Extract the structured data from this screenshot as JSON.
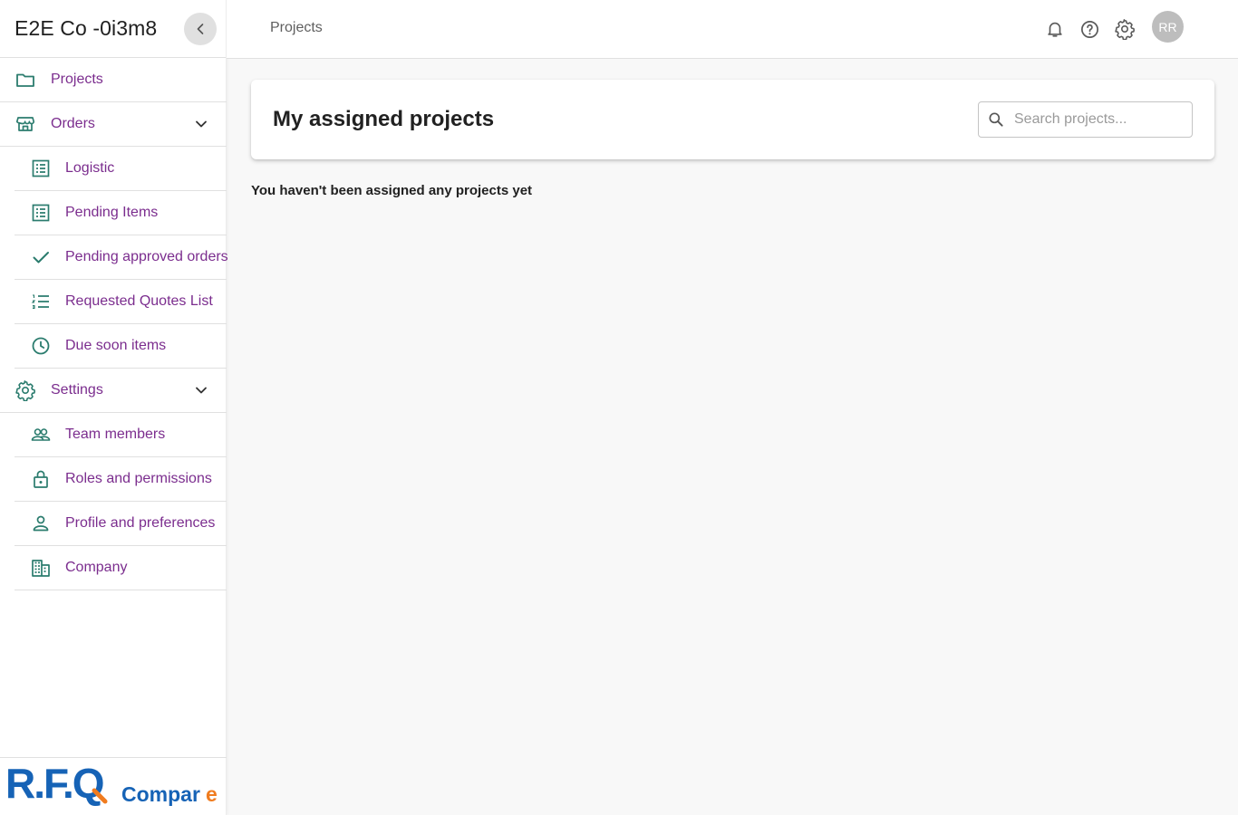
{
  "sidebar": {
    "company_name": "E2E Co -0i3m8",
    "items": [
      {
        "label": "Projects",
        "icon": "folder-icon"
      },
      {
        "label": "Orders",
        "icon": "storefront-icon",
        "expanded": true
      },
      {
        "label": "Logistic",
        "icon": "list-alt-icon"
      },
      {
        "label": "Pending Items",
        "icon": "list-alt-icon"
      },
      {
        "label": "Pending approved orders",
        "icon": "check-icon"
      },
      {
        "label": "Requested Quotes List",
        "icon": "format-list-numbered-icon"
      },
      {
        "label": "Due soon items",
        "icon": "clock-icon"
      },
      {
        "label": "Settings",
        "icon": "gear-icon",
        "expanded": true
      },
      {
        "label": "Team members",
        "icon": "people-icon"
      },
      {
        "label": "Roles and permissions",
        "icon": "lock-icon"
      },
      {
        "label": "Profile and preferences",
        "icon": "person-icon"
      },
      {
        "label": "Company",
        "icon": "building-icon"
      }
    ],
    "logo": {
      "text_main": "R.F.Q",
      "text_sub": "Compare"
    }
  },
  "topbar": {
    "breadcrumb": "Projects",
    "avatar_initials": "RR"
  },
  "main": {
    "title": "My assigned projects",
    "search_placeholder": "Search projects...",
    "empty_message": "You haven't been assigned any projects yet"
  },
  "colors": {
    "accent_purple": "#7b2d8e",
    "icon_teal": "#2b7c6e",
    "logo_blue": "#1663b6",
    "logo_orange": "#f07c1f"
  }
}
